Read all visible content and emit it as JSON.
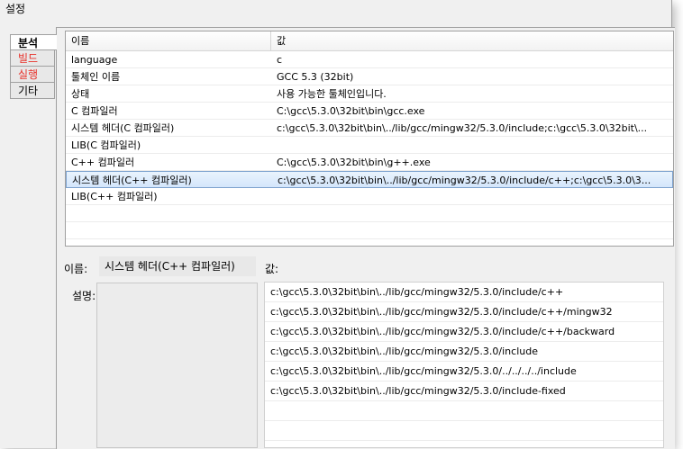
{
  "window": {
    "title": "설정"
  },
  "sidebar": {
    "tabs": [
      {
        "label": "분석",
        "color": "#000000"
      },
      {
        "label": "빌드",
        "color": "#e8312a"
      },
      {
        "label": "실행",
        "color": "#e8312a"
      },
      {
        "label": "기타",
        "color": "#000000"
      }
    ]
  },
  "grid": {
    "headers": {
      "name": "이름",
      "value": "값"
    },
    "rows": [
      {
        "name": "language",
        "value": "c"
      },
      {
        "name": "툴체인 이름",
        "value": "GCC 5.3 (32bit)"
      },
      {
        "name": "상태",
        "value": "사용 가능한 툴체인입니다."
      },
      {
        "name": "C 컴파일러",
        "value": "C:\\gcc\\5.3.0\\32bit\\bin\\gcc.exe"
      },
      {
        "name": "시스템 헤더(C 컴파일러)",
        "value": "c:\\gcc\\5.3.0\\32bit\\bin\\../lib/gcc/mingw32/5.3.0/include;c:\\gcc\\5.3.0\\32bit\\..."
      },
      {
        "name": "LIB(C 컴파일러)",
        "value": ""
      },
      {
        "name": "C++ 컴파일러",
        "value": "C:\\gcc\\5.3.0\\32bit\\bin\\g++.exe"
      },
      {
        "name": "시스템 헤더(C++ 컴파일러)",
        "value": "c:\\gcc\\5.3.0\\32bit\\bin\\../lib/gcc/mingw32/5.3.0/include/c++;c:\\gcc\\5.3.0\\3..."
      },
      {
        "name": "LIB(C++ 컴파일러)",
        "value": ""
      }
    ],
    "selected_index": 7
  },
  "detail": {
    "name_label": "이름:",
    "name_value": "시스템 헤더(C++ 컴파일러)",
    "value_label": "값:",
    "desc_label": "설명:",
    "values": [
      "c:\\gcc\\5.3.0\\32bit\\bin\\../lib/gcc/mingw32/5.3.0/include/c++",
      "c:\\gcc\\5.3.0\\32bit\\bin\\../lib/gcc/mingw32/5.3.0/include/c++/mingw32",
      "c:\\gcc\\5.3.0\\32bit\\bin\\../lib/gcc/mingw32/5.3.0/include/c++/backward",
      "c:\\gcc\\5.3.0\\32bit\\bin\\../lib/gcc/mingw32/5.3.0/include",
      "c:\\gcc\\5.3.0\\32bit\\bin\\../lib/gcc/mingw32/5.3.0/../../../../include",
      "c:\\gcc\\5.3.0\\32bit\\bin\\../lib/gcc/mingw32/5.3.0/include-fixed"
    ]
  }
}
